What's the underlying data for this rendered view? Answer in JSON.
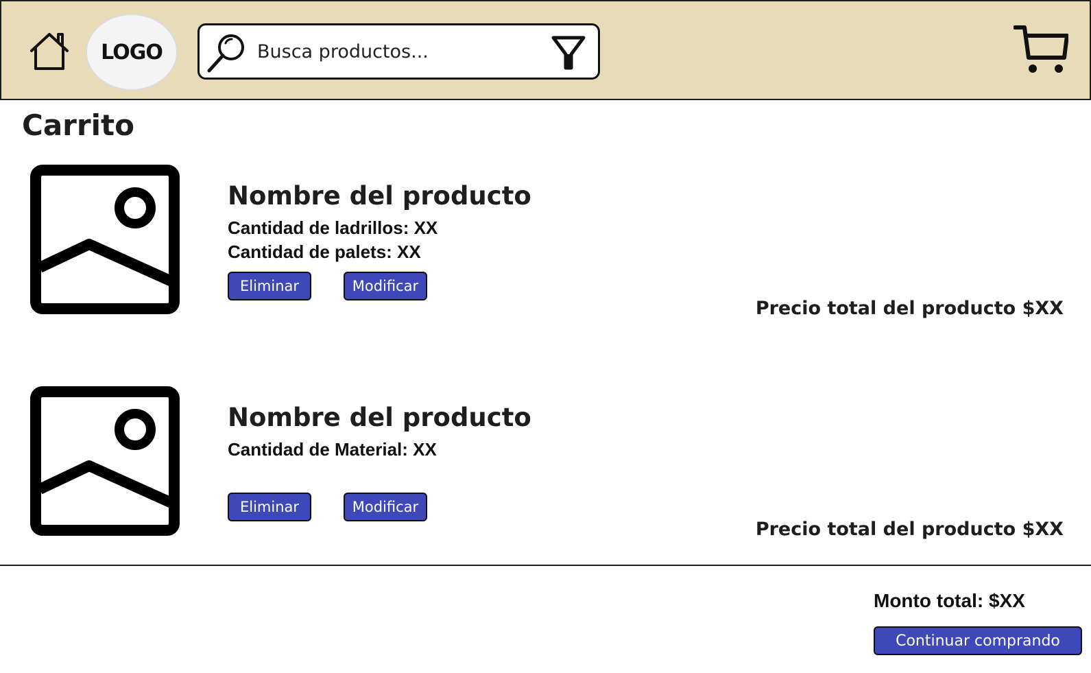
{
  "header": {
    "home_icon": "home-icon",
    "logo_text": "LOGO",
    "search": {
      "placeholder": "Busca productos...",
      "value": "",
      "search_icon": "search-icon",
      "filter_icon": "filter-icon"
    },
    "cart_icon": "cart-icon"
  },
  "page": {
    "title": "Carrito"
  },
  "items": [
    {
      "image_icon": "image-placeholder-icon",
      "name": "Nombre del producto",
      "details": [
        "Cantidad de ladrillos: XX",
        "Cantidad de palets: XX"
      ],
      "delete_label": "Eliminar",
      "modify_label": "Modificar",
      "price": "Precio total del producto $XX"
    },
    {
      "image_icon": "image-placeholder-icon",
      "name": "Nombre del producto",
      "details": [
        "Cantidad de Material: XX"
      ],
      "delete_label": "Eliminar",
      "modify_label": "Modificar",
      "price": "Precio total del producto $XX"
    }
  ],
  "summary": {
    "total": "Monto total: $XX",
    "continue_label": "Continuar comprando"
  },
  "colors": {
    "header_bg": "#e8dcb8",
    "button_bg": "#3f48b8",
    "text": "#1e1e1e"
  }
}
